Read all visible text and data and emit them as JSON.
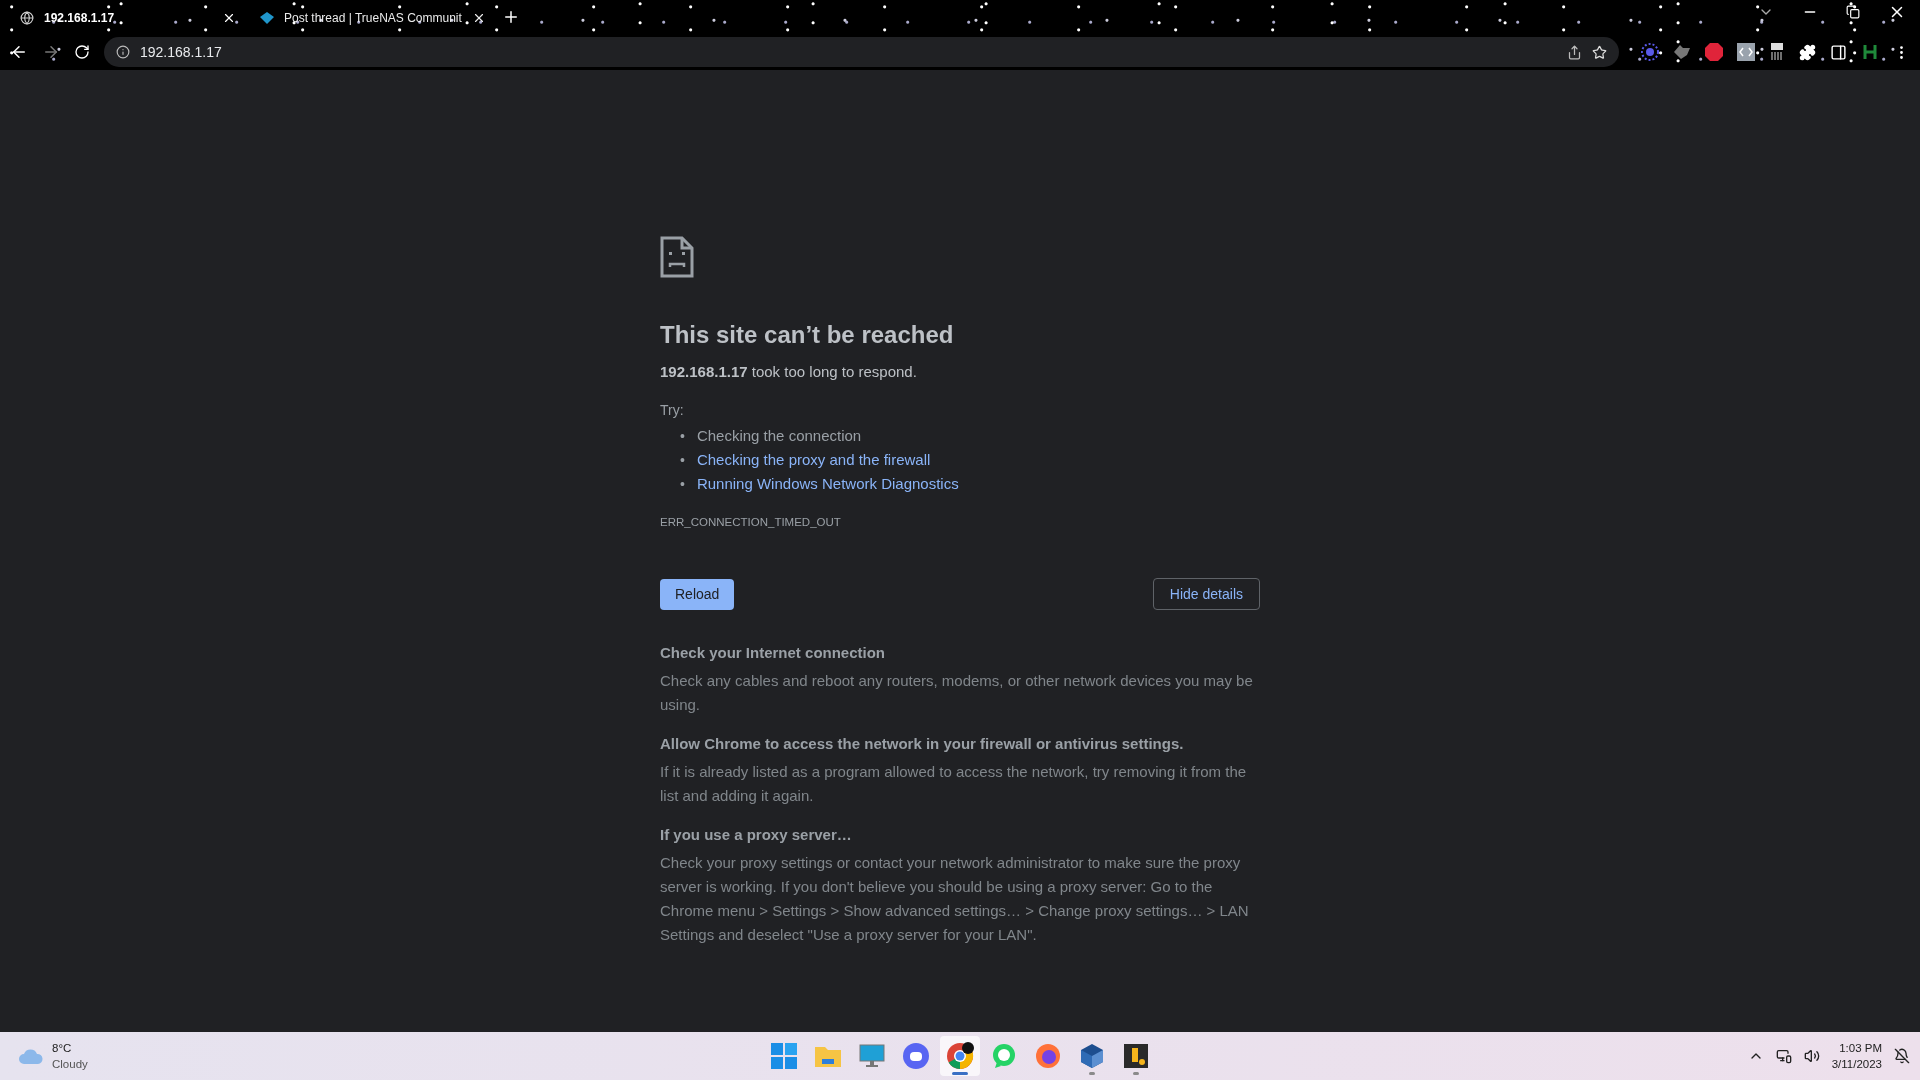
{
  "tabs": [
    {
      "title": "192.168.1.17",
      "selected": true
    },
    {
      "title": "Post thread | TrueNAS Communit",
      "selected": false
    }
  ],
  "address_bar": {
    "url": "192.168.1.17"
  },
  "error_page": {
    "title": "This site can’t be reached",
    "message": "**192.168.1.17** took too long to respond.",
    "try_label": "Try:",
    "suggestions": [
      {
        "marker": "•",
        "text": "Checking the connection",
        "link": false
      },
      {
        "marker": "•",
        "text": "Checking the proxy and the firewall",
        "link": true
      },
      {
        "marker": "•",
        "text": "Running Windows Network Diagnostics",
        "link": true
      }
    ],
    "error_code": "ERR_CONNECTION_TIMED_OUT",
    "reload_button": "Reload",
    "details_button": "Hide details",
    "details": [
      {
        "heading": "Check your Internet connection",
        "body": "Check any cables and reboot any routers, modems, or other network devices you may be using."
      },
      {
        "heading": "Allow Chrome to access the network in your firewall or antivirus settings.",
        "body": "If it is already listed as a program allowed to access the network, try removing it from the list and adding it again."
      },
      {
        "heading": "If you use a proxy server…",
        "body": "Check your proxy settings or contact your network administrator to make sure the proxy server is working. If you don't believe you should be using a proxy server: Go to the Chrome menu > Settings > Show advanced settings… > Change proxy settings… > LAN Settings and deselect \"Use a proxy server for your LAN\"."
      }
    ]
  },
  "taskbar": {
    "weather": {
      "temperature": "8°C",
      "condition": "Cloudy"
    },
    "apps": [
      {
        "running": false,
        "selected": false
      },
      {
        "running": false,
        "selected": false
      },
      {
        "running": false,
        "selected": false
      },
      {
        "running": false,
        "selected": false
      },
      {
        "running": true,
        "selected": true
      },
      {
        "running": false,
        "selected": false
      },
      {
        "running": false,
        "selected": false
      },
      {
        "running": true,
        "selected": false
      },
      {
        "running": true,
        "selected": false
      }
    ],
    "clock": {
      "time": "1:03 PM",
      "date": "3/11/2023"
    }
  }
}
